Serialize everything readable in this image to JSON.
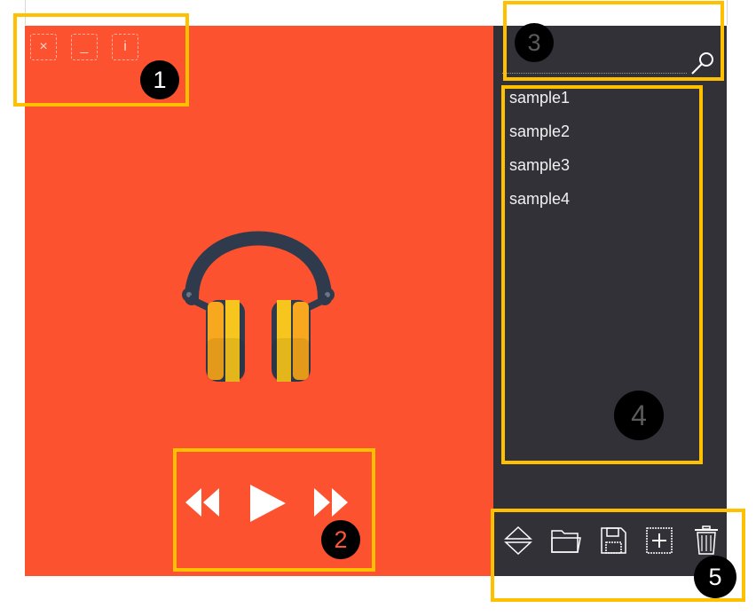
{
  "window": {
    "buttons": [
      {
        "name": "close",
        "glyph": "×"
      },
      {
        "name": "minimize",
        "glyph": "_"
      },
      {
        "name": "info",
        "glyph": "i"
      }
    ]
  },
  "colors": {
    "player_bg": "#fd5230",
    "sidebar_bg": "#323138",
    "annotation": "#ffc000",
    "headphone_band": "#2f3b4c",
    "headphone_cup": "#f5a623"
  },
  "playlist": {
    "items": [
      "sample1",
      "sample2",
      "sample3",
      "sample4"
    ]
  },
  "toolbar": {
    "icons": [
      "sort-icon",
      "open-folder-icon",
      "save-icon",
      "add-icon",
      "delete-icon"
    ]
  },
  "annotations": {
    "labels": [
      "1",
      "2",
      "3",
      "4",
      "5"
    ]
  }
}
